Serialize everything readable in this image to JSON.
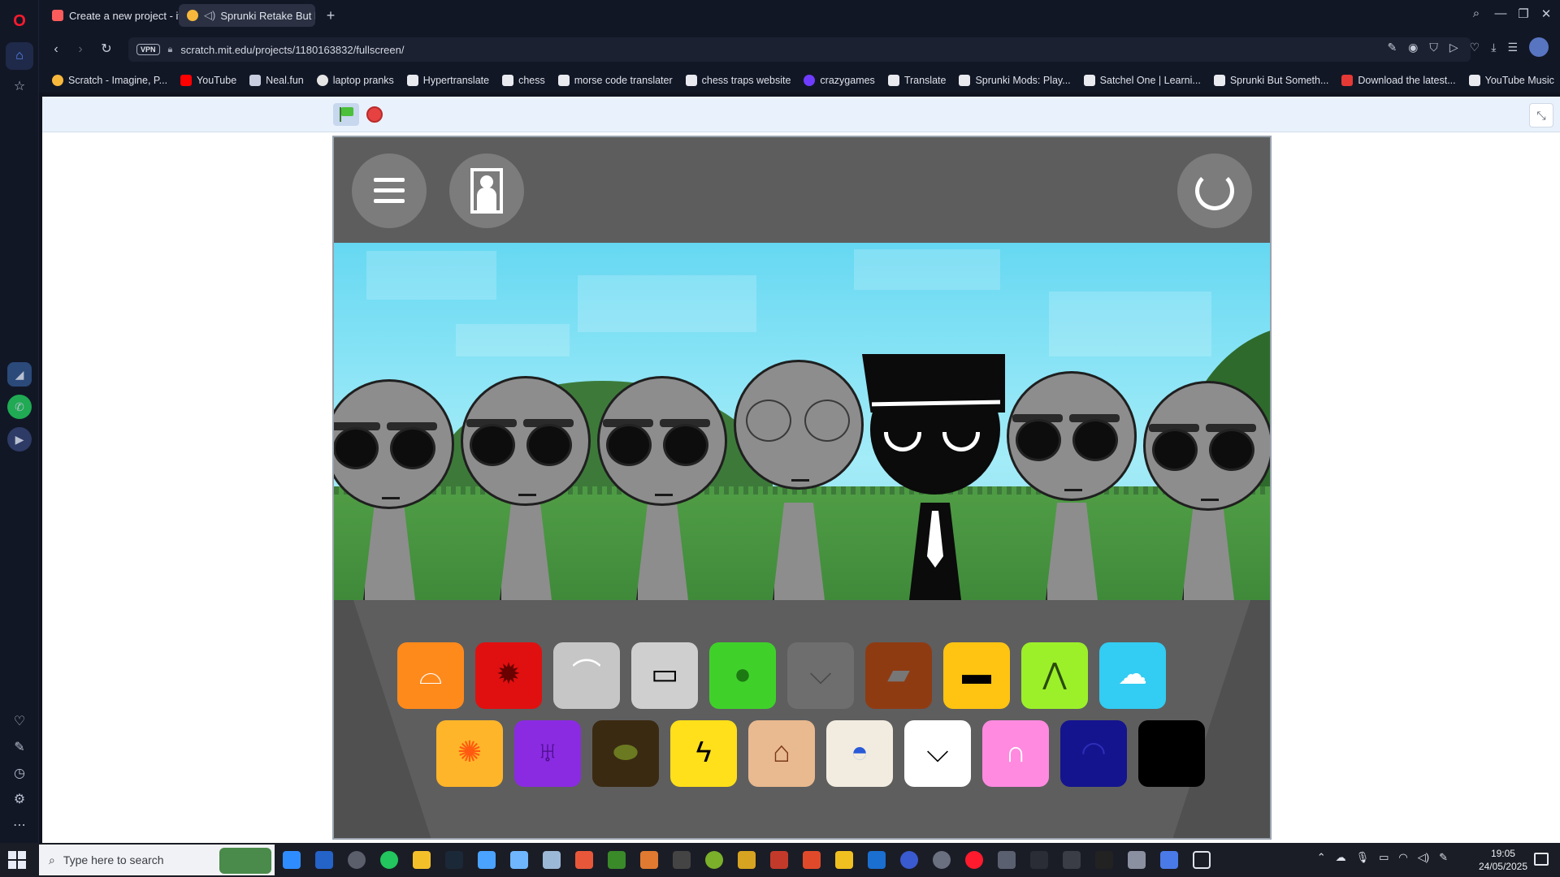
{
  "browser": {
    "tabs": [
      {
        "label": "Create a new project - itch",
        "favicon_color": "#fa5c5c"
      },
      {
        "label": "Sprunki Retake But be",
        "favicon_color": "#f7b83c"
      }
    ],
    "url": "scratch.mit.edu/projects/1180163832/fullscreen/",
    "vpn_label": "VPN",
    "bookmarks": [
      "Scratch - Imagine, P...",
      "YouTube",
      "Neal.fun",
      "laptop pranks",
      "Hypertranslate",
      "chess",
      "morse code translater",
      "chess traps website",
      "crazygames",
      "Translate",
      "Sprunki Mods: Play...",
      "Satchel One | Learni...",
      "Sprunki But Someth...",
      "Download the latest...",
      "YouTube Music"
    ]
  },
  "game": {
    "icons_row1": [
      {
        "name": "orange-crab-icon",
        "color": "#ff8a1c"
      },
      {
        "name": "red-spikes-icon",
        "color": "#e01010"
      },
      {
        "name": "gray-dish-icon",
        "color": "#c6c6c6"
      },
      {
        "name": "radio-icon",
        "color": "#cfcfcf"
      },
      {
        "name": "green-pumpkin-icon",
        "color": "#3fd12a"
      },
      {
        "name": "cat-ears-icon",
        "color": "#6e6e6e"
      },
      {
        "name": "bucket-icon",
        "color": "#8f3b12"
      },
      {
        "name": "yellow-hat-icon",
        "color": "#ffc412"
      },
      {
        "name": "green-spikes-icon",
        "color": "#9cf02a"
      },
      {
        "name": "headphones-icon",
        "color": "#33ccf2"
      }
    ],
    "icons_row2": [
      {
        "name": "sun-icon",
        "color": "#ffb52a"
      },
      {
        "name": "purple-horns-icon",
        "color": "#8a2be2"
      },
      {
        "name": "brown-bush-icon",
        "color": "#3b2a12"
      },
      {
        "name": "lightning-icon",
        "color": "#ffe01a"
      },
      {
        "name": "cowboy-hat-icon",
        "color": "#e9b98f"
      },
      {
        "name": "propeller-cap-icon",
        "color": "#f2ece0"
      },
      {
        "name": "white-cat-icon",
        "color": "#ffffff"
      },
      {
        "name": "bunny-ears-icon",
        "color": "#ff8ae0"
      },
      {
        "name": "blue-dome-icon",
        "color": "#14148f"
      },
      {
        "name": "black-square-icon",
        "color": "#000000"
      }
    ]
  },
  "taskbar": {
    "search_placeholder": "Type here to search",
    "time": "19:05",
    "date": "24/05/2025"
  }
}
